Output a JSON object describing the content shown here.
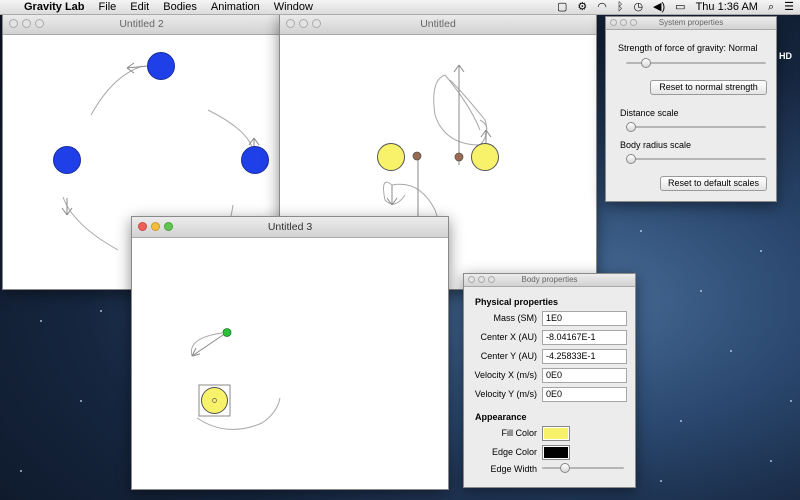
{
  "menubar": {
    "apple_glyph": "",
    "app_name": "Gravity Lab",
    "menus": [
      "File",
      "Edit",
      "Bodies",
      "Animation",
      "Window"
    ],
    "clock": "Thu 1:36 AM",
    "hd": "HD"
  },
  "windows": {
    "untitled2": {
      "title": "Untitled 2"
    },
    "untitled": {
      "title": "Untitled"
    },
    "untitled3": {
      "title": "Untitled 3"
    }
  },
  "system_properties": {
    "title": "System properties",
    "gravity_label": "Strength of force of gravity: Normal",
    "gravity_level": 0.05,
    "reset_strength_label": "Reset to normal strength",
    "distance_label": "Distance scale",
    "distance_level": 0.0,
    "radius_label": "Body radius scale",
    "radius_level": 0.0,
    "reset_scales_label": "Reset to default scales"
  },
  "body_properties": {
    "title": "Body properties",
    "physical_heading": "Physical properties",
    "mass_label": "Mass (SM)",
    "mass_value": "1E0",
    "cx_label": "Center X (AU)",
    "cx_value": "-8.04167E-1",
    "cy_label": "Center Y (AU)",
    "cy_value": "-4.25833E-1",
    "vx_label": "Velocity X (m/s)",
    "vx_value": "0E0",
    "vy_label": "Velocity Y (m/s)",
    "vy_value": "0E0",
    "appearance_heading": "Appearance",
    "fill_label": "Fill Color",
    "fill_color": "#f7f26a",
    "edge_label": "Edge Color",
    "edge_color": "#000000",
    "width_label": "Edge Width",
    "width_level": 0.25
  },
  "colors": {
    "blue_body": "#1f3fe8",
    "yellow_body": "#f7f26a",
    "brown_body": "#9a6a50",
    "green_body": "#2bbf3a"
  }
}
